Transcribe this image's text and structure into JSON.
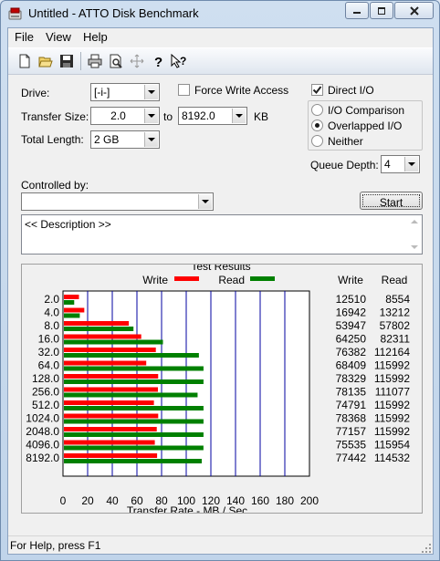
{
  "window": {
    "title": "Untitled - ATTO Disk Benchmark"
  },
  "menu": {
    "file": "File",
    "view": "View",
    "help": "Help"
  },
  "form": {
    "drive_label": "Drive:",
    "drive_value": "[-i-]",
    "force_write_label": "Force Write Access",
    "force_write_checked": false,
    "direct_io_label": "Direct I/O",
    "direct_io_checked": true,
    "transfer_size_label": "Transfer Size:",
    "transfer_from": "2.0",
    "to_label": "to",
    "transfer_to": "8192.0",
    "kb_label": "KB",
    "total_length_label": "Total Length:",
    "total_length_value": "2 GB",
    "io_options": [
      "I/O Comparison",
      "Overlapped I/O",
      "Neither"
    ],
    "io_selected": "Overlapped I/O",
    "queue_depth_label": "Queue Depth:",
    "queue_depth_value": "4",
    "controlled_by_label": "Controlled by:",
    "controlled_by_value": "",
    "start_label": "Start",
    "description": "<< Description >>"
  },
  "results": {
    "title": "Test Results",
    "legend_write": "Write",
    "legend_read": "Read",
    "col_write": "Write",
    "col_read": "Read",
    "write_color": "#ff0000",
    "read_color": "#008000",
    "grid_color": "#0000a0",
    "rows": [
      {
        "size": "2.0",
        "write": "12510",
        "read": "8554"
      },
      {
        "size": "4.0",
        "write": "16942",
        "read": "13212"
      },
      {
        "size": "8.0",
        "write": "53947",
        "read": "57802"
      },
      {
        "size": "16.0",
        "write": "64250",
        "read": "82311"
      },
      {
        "size": "32.0",
        "write": "76382",
        "read": "112164"
      },
      {
        "size": "64.0",
        "write": "68409",
        "read": "115992"
      },
      {
        "size": "128.0",
        "write": "78329",
        "read": "115992"
      },
      {
        "size": "256.0",
        "write": "78135",
        "read": "111077"
      },
      {
        "size": "512.0",
        "write": "74791",
        "read": "115992"
      },
      {
        "size": "1024.0",
        "write": "78368",
        "read": "115992"
      },
      {
        "size": "2048.0",
        "write": "77157",
        "read": "115992"
      },
      {
        "size": "4096.0",
        "write": "75535",
        "read": "115954"
      },
      {
        "size": "8192.0",
        "write": "77442",
        "read": "114532"
      }
    ]
  },
  "chart_data": {
    "type": "bar",
    "orientation": "horizontal",
    "categories": [
      "2.0",
      "4.0",
      "8.0",
      "16.0",
      "32.0",
      "64.0",
      "128.0",
      "256.0",
      "512.0",
      "1024.0",
      "2048.0",
      "4096.0",
      "8192.0"
    ],
    "series": [
      {
        "name": "Write",
        "values": [
          12510,
          16942,
          53947,
          64250,
          76382,
          68409,
          78329,
          78135,
          74791,
          78368,
          77157,
          75535,
          77442
        ]
      },
      {
        "name": "Read",
        "values": [
          8554,
          13212,
          57802,
          82311,
          112164,
          115992,
          115992,
          111077,
          115992,
          115992,
          115992,
          115954,
          114532
        ]
      }
    ],
    "xlabel": "Transfer Rate - MB / Sec",
    "xticks": [
      "0",
      "20",
      "40",
      "60",
      "80",
      "100",
      "120",
      "140",
      "160",
      "180",
      "200"
    ],
    "xlim": [
      0,
      200
    ],
    "grid": true,
    "legend": "top"
  },
  "status": {
    "text": "For Help, press F1"
  }
}
